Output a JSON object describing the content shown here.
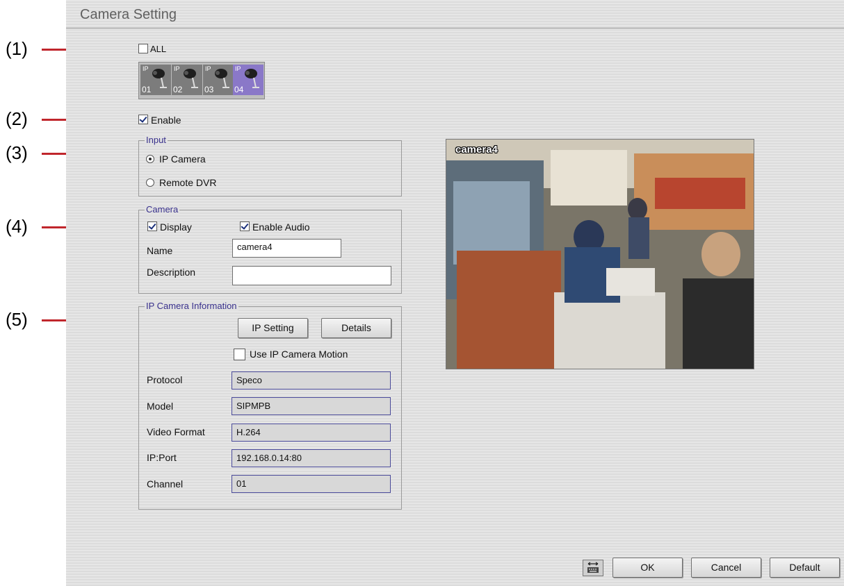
{
  "window": {
    "title": "Camera Setting"
  },
  "callouts": [
    "(1)",
    "(2)",
    "(3)",
    "(4)",
    "(5)"
  ],
  "select_all": {
    "label": "ALL",
    "checked": false
  },
  "cameras": [
    {
      "ip_tag": "IP",
      "number": "01"
    },
    {
      "ip_tag": "IP",
      "number": "02"
    },
    {
      "ip_tag": "IP",
      "number": "03"
    },
    {
      "ip_tag": "IP",
      "number": "04",
      "selected": true
    }
  ],
  "enable": {
    "label": "Enable",
    "checked": true
  },
  "input_group": {
    "title": "Input",
    "options": [
      "IP Camera",
      "Remote DVR"
    ],
    "selected": "IP Camera"
  },
  "camera_group": {
    "title": "Camera",
    "display_label": "Display",
    "enable_audio_label": "Enable Audio",
    "name_label": "Name",
    "name_value": "camera4",
    "description_label": "Description",
    "description_value": ""
  },
  "ip_info": {
    "title": "IP Camera Information",
    "ip_setting_button": "IP Setting",
    "details_button": "Details",
    "use_motion_label": "Use IP Camera Motion",
    "protocol_label": "Protocol",
    "protocol_value": "Speco",
    "model_label": "Model",
    "model_value": "SIPMPB",
    "video_format_label": "Video Format",
    "video_format_value": "H.264",
    "ip_port_label": "IP:Port",
    "ip_port_value": "192.168.0.14:80",
    "channel_label": "Channel",
    "channel_value": "01"
  },
  "preview": {
    "label": "camera4"
  },
  "footer": {
    "ok": "OK",
    "cancel": "Cancel",
    "default": "Default"
  },
  "colors": {
    "accent": "#38308c",
    "callout_line": "#c0262c",
    "selected_thumb": "#8a78c8"
  }
}
